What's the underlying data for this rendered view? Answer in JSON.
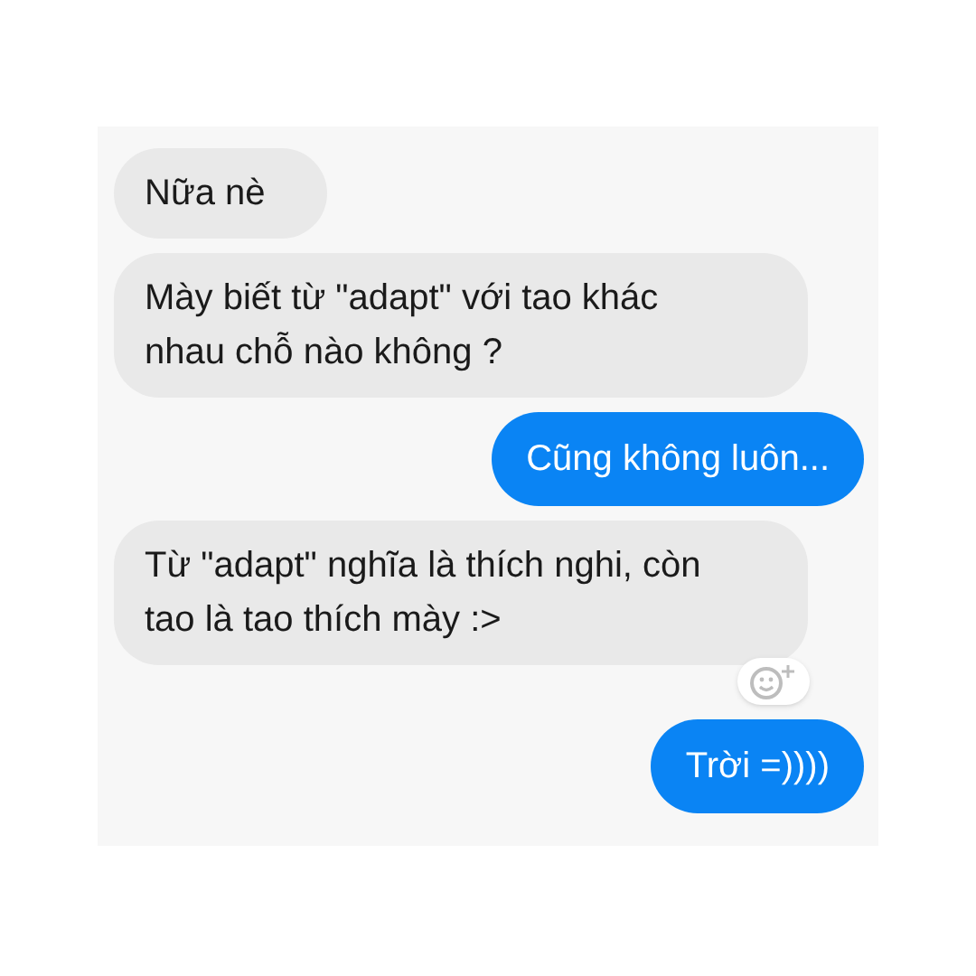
{
  "messages": [
    {
      "kind": "received",
      "text": "Nữa nè",
      "reaction_button": false
    },
    {
      "kind": "received",
      "text": "Mày biết từ \"adapt\" với tao khác nhau chỗ nào không ?",
      "reaction_button": false
    },
    {
      "kind": "sent",
      "text": "Cũng không luôn...",
      "reaction_button": false
    },
    {
      "kind": "received",
      "text": "Từ \"adapt\" nghĩa là thích nghi, còn tao là tao thích mày :>",
      "reaction_button": true
    },
    {
      "kind": "sent",
      "text": "Trời =))))",
      "reaction_button": false
    }
  ]
}
